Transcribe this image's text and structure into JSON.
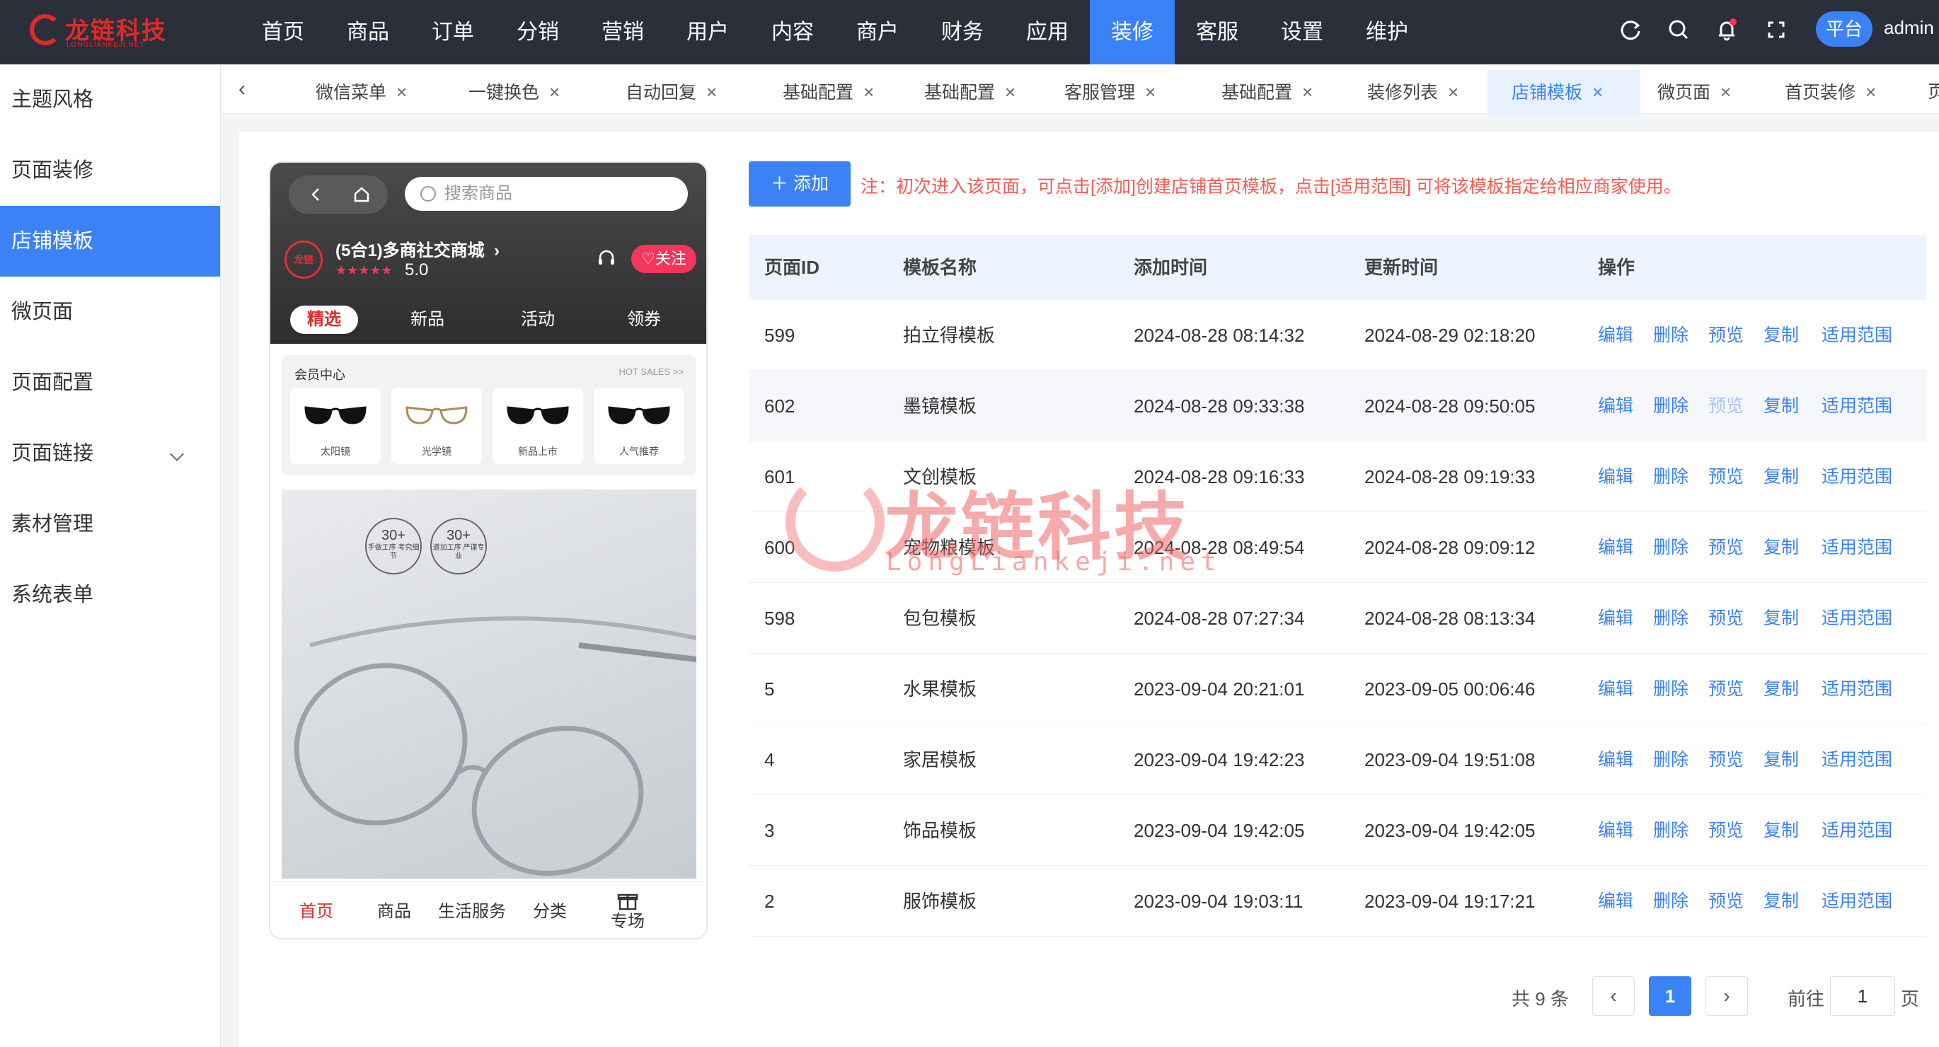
{
  "brand": {
    "title": "龙链科技",
    "subtitle": "LONGLIANKEJI.NET"
  },
  "nav": [
    "首页",
    "商品",
    "订单",
    "分销",
    "营销",
    "用户",
    "内容",
    "商户",
    "财务",
    "应用",
    "装修",
    "客服",
    "设置",
    "维护"
  ],
  "nav_active": "装修",
  "topbar_right": {
    "platform_label": "平台",
    "user": "admin"
  },
  "sidebar": [
    "主题风格",
    "页面装修",
    "店铺模板",
    "微页面",
    "页面配置",
    "页面链接",
    "素材管理",
    "系统表单"
  ],
  "sidebar_active": "店铺模板",
  "tabs": [
    "微信菜单",
    "一键换色",
    "自动回复",
    "基础配置",
    "基础配置",
    "客服管理",
    "基础配置",
    "装修列表",
    "店铺模板",
    "微页面",
    "首页装修",
    "页面配置"
  ],
  "tab_active": "店铺模板",
  "phone": {
    "search_placeholder": "搜索商品",
    "logo_text": "龙链",
    "shop_name": "(5合1)多商社交商城",
    "rating": "5.0",
    "stars": "★★★★★",
    "follow": "关注",
    "categories": [
      "精选",
      "新品",
      "活动",
      "领券"
    ],
    "member_title": "会员中心",
    "member_hot": "HOT SALES >>",
    "products": [
      "太阳镜",
      "光学镜",
      "新品上市",
      "人气推荐"
    ],
    "badges": [
      {
        "num": "30+",
        "txt": "手做工序 考究细节"
      },
      {
        "num": "30+",
        "txt": "道加工序 严谨专业"
      }
    ],
    "tabbar": [
      "首页",
      "商品",
      "生活服务",
      "分类",
      "专场"
    ]
  },
  "toolbar": {
    "add_label": "添加",
    "note": "注：初次进入该页面，可点击[添加]创建店铺首页模板，点击[适用范围] 可将该模板指定给相应商家使用。"
  },
  "table": {
    "headers": [
      "页面ID",
      "模板名称",
      "添加时间",
      "更新时间",
      "操作"
    ],
    "actions": [
      "编辑",
      "删除",
      "预览",
      "复制",
      "适用范围"
    ],
    "rows": [
      {
        "id": "599",
        "name": "拍立得模板",
        "added": "2024-08-28 08:14:32",
        "updated": "2024-08-29 02:18:20"
      },
      {
        "id": "602",
        "name": "墨镜模板",
        "added": "2024-08-28 09:33:38",
        "updated": "2024-08-28 09:50:05"
      },
      {
        "id": "601",
        "name": "文创模板",
        "added": "2024-08-28 09:16:33",
        "updated": "2024-08-28 09:19:33"
      },
      {
        "id": "600",
        "name": "宠物粮模板",
        "added": "2024-08-28 08:49:54",
        "updated": "2024-08-28 09:09:12"
      },
      {
        "id": "598",
        "name": "包包模板",
        "added": "2024-08-28 07:27:34",
        "updated": "2024-08-28 08:13:34"
      },
      {
        "id": "5",
        "name": "水果模板",
        "added": "2023-09-04 20:21:01",
        "updated": "2023-09-05 00:06:46"
      },
      {
        "id": "4",
        "name": "家居模板",
        "added": "2023-09-04 19:42:23",
        "updated": "2023-09-04 19:51:08"
      },
      {
        "id": "3",
        "name": "饰品模板",
        "added": "2023-09-04 19:42:05",
        "updated": "2023-09-04 19:42:05"
      },
      {
        "id": "2",
        "name": "服饰模板",
        "added": "2023-09-04 19:03:11",
        "updated": "2023-09-04 19:17:21"
      }
    ]
  },
  "watermark": {
    "title": "龙链科技",
    "sub": "LongLiankeji.net"
  },
  "pagination": {
    "total": "共 9 条",
    "current": "1",
    "goto_label": "前往",
    "goto_value": "1",
    "unit": "页"
  },
  "colors": {
    "accent": "#3b82f6",
    "topbar": "#2b2f3a",
    "brand_red": "#e02a2a",
    "note": "#f25c54"
  }
}
